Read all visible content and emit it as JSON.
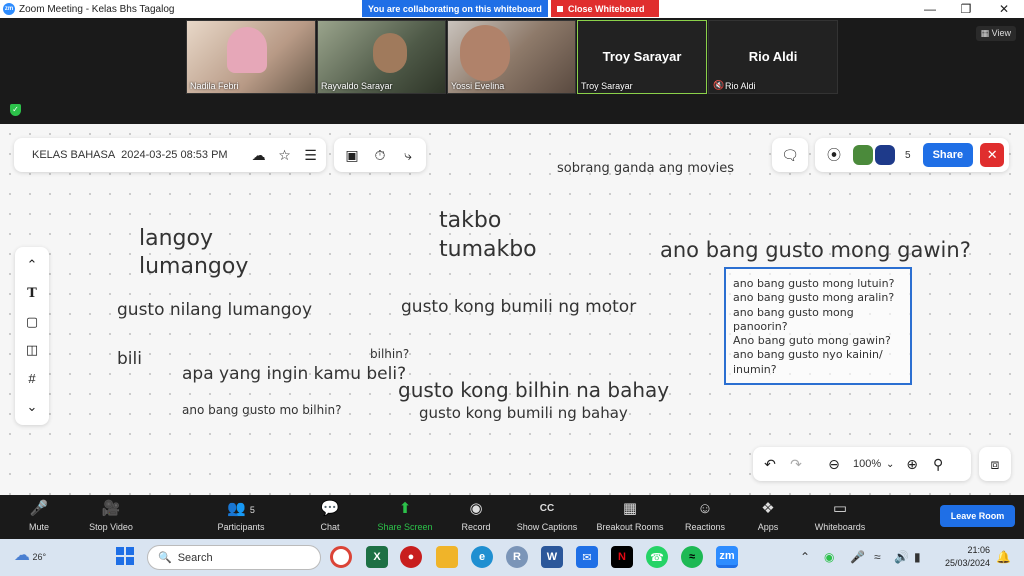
{
  "titlebar": {
    "app_title": "Zoom Meeting - Kelas Bhs Tagalog",
    "collab_banner": "You are collaborating on this whiteboard",
    "close_whiteboard": "Close Whiteboard"
  },
  "participants_strip": {
    "view_label": "View",
    "tiles": [
      {
        "name": "Nadila Febri",
        "bg": "#c9b6a6"
      },
      {
        "name": "Rayvaldo Sarayar",
        "bg": "#5f6b5c"
      },
      {
        "name": "Yossi Evelina",
        "bg": "#8e7a6a"
      },
      {
        "name": "Troy Sarayar",
        "big": "Troy Sarayar",
        "bg": "#222222"
      },
      {
        "name": "Rio Aldi",
        "big": "Rio Aldi",
        "bg": "#222222"
      }
    ]
  },
  "whiteboard": {
    "title": "KELAS BAHASA",
    "datetime": "2024-03-25 08:53 PM",
    "collab_count": "5",
    "share_label": "Share",
    "zoom_level": "100%",
    "notes": [
      "sobrang ganda ang movies",
      "langoy",
      "lumangoy",
      "takbo",
      "tumakbo",
      "ano bang gusto mong gawin?",
      "gusto nilang lumangoy",
      "gusto kong bumili ng motor",
      "bilhin?",
      "bili",
      "apa yang ingin kamu beli?",
      "gusto kong bilhin na bahay",
      "ano bang gusto mo bilhin?",
      "gusto kong bumili ng bahay"
    ],
    "box_lines": [
      "ano bang gusto mong lutuin?",
      "ano bang gusto mong aralin?",
      "ano bang gusto mong",
      "panoorin?",
      "Ano bang guto mong gawin?",
      "ano bang gusto nyo kainin/",
      "inumin?"
    ]
  },
  "toolbar": {
    "mute": "Mute",
    "stop_video": "Stop Video",
    "participants": "Participants",
    "participants_count": "5",
    "chat": "Chat",
    "share_screen": "Share Screen",
    "record": "Record",
    "show_captions": "Show Captions",
    "breakout_rooms": "Breakout Rooms",
    "reactions": "Reactions",
    "apps": "Apps",
    "whiteboards": "Whiteboards",
    "leave_room": "Leave Room"
  },
  "taskbar": {
    "weather_temp": "26°",
    "search_placeholder": "Search",
    "time": "21:06",
    "date": "25/03/2024"
  },
  "colors": {
    "accent": "#1f6fe6",
    "danger": "#e02e2e",
    "green": "#2cc14a"
  }
}
